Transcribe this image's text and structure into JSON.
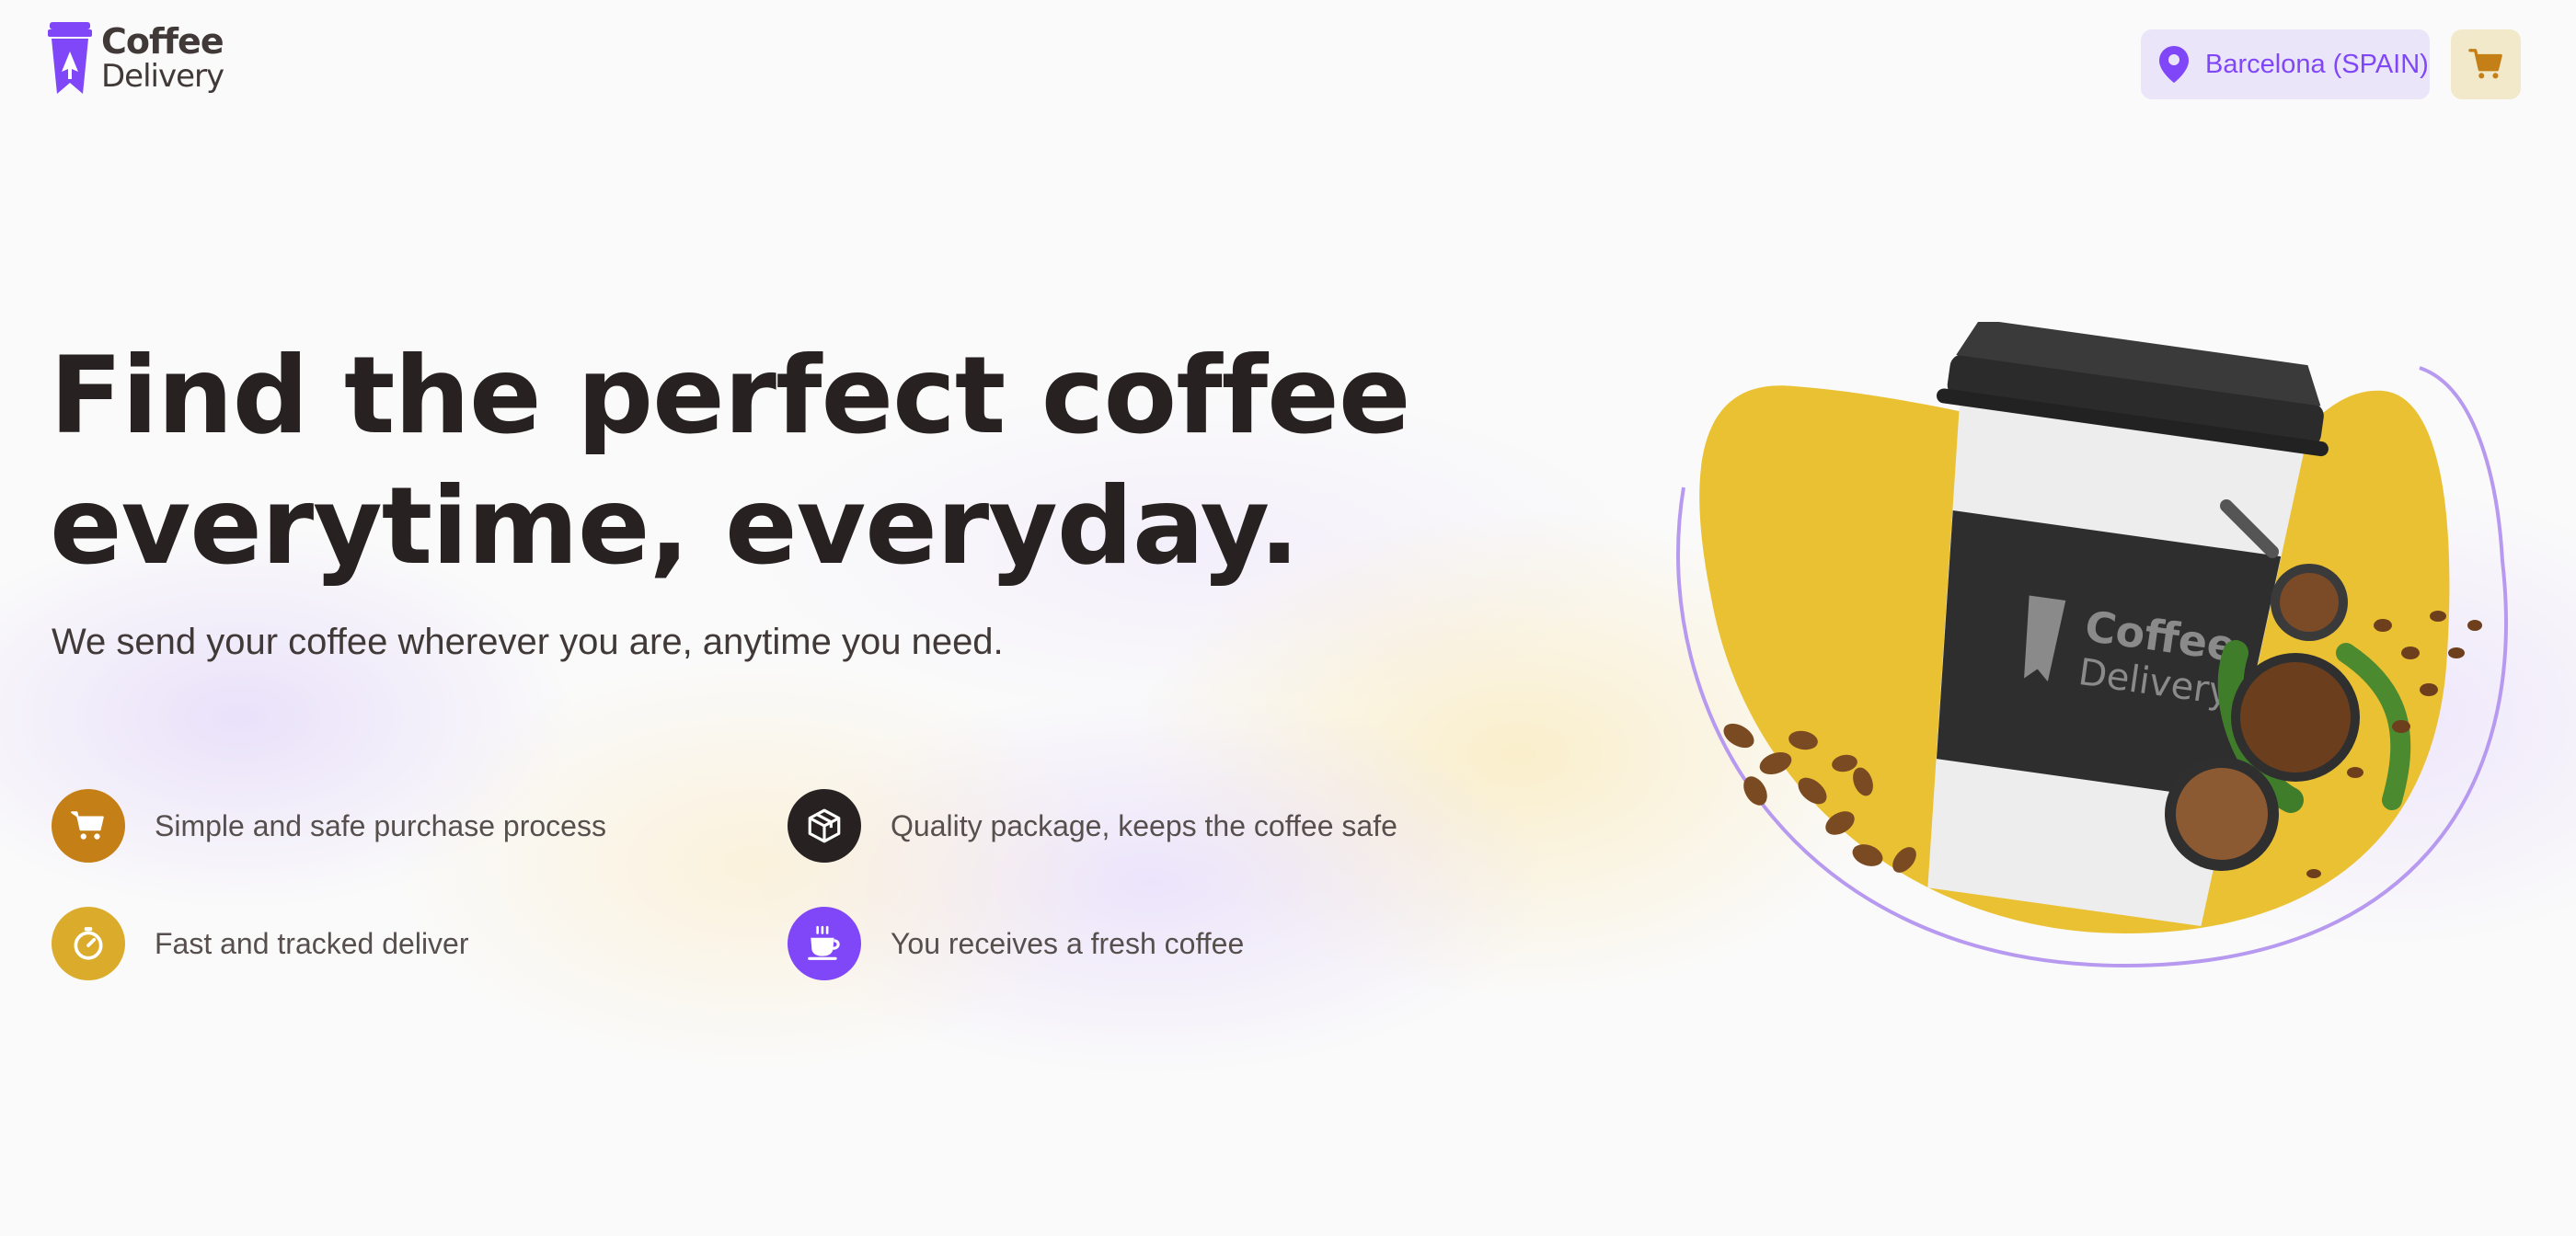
{
  "brand": {
    "line1": "Coffee",
    "line2": "Delivery"
  },
  "header": {
    "location_label": "Barcelona (SPAIN)",
    "location_icon": "map-pin-icon",
    "cart_icon": "shopping-cart-icon"
  },
  "hero": {
    "title_line1": "Find the perfect coffee",
    "title_line2": "everytime, everyday.",
    "subtitle": "We send your coffee wherever you are, anytime you need."
  },
  "features": [
    {
      "label": "Simple and safe purchase process",
      "icon": "shopping-cart-icon",
      "color": "#C47F17"
    },
    {
      "label": "Quality package, keeps the coffee safe",
      "icon": "package-icon",
      "color": "#272221"
    },
    {
      "label": "Fast and tracked deliver",
      "icon": "timer-icon",
      "color": "#DBAC2C"
    },
    {
      "label": "You receives a fresh coffee",
      "icon": "coffee-cup-icon",
      "color": "#8047F8"
    }
  ],
  "illustration": {
    "cup_line1": "Coffee",
    "cup_line2": "Delivery"
  },
  "colors": {
    "background": "#FAFAFA",
    "purple": "#8047F8",
    "purple_light": "#EBE5F9",
    "yellow": "#DBAC2C",
    "yellow_dark": "#C47F17",
    "yellow_light": "#F1E9C9",
    "title": "#272221",
    "text": "#574F4D"
  }
}
